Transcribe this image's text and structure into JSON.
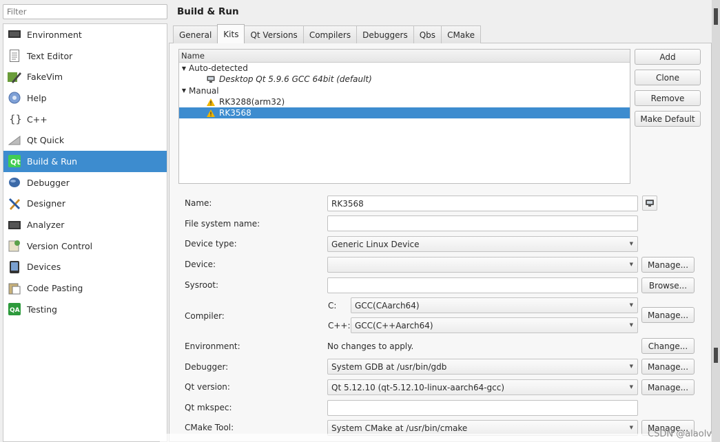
{
  "filter": {
    "placeholder": "Filter"
  },
  "sidebar": {
    "items": [
      {
        "label": "Environment",
        "icon": "monitor-icon"
      },
      {
        "label": "Text Editor",
        "icon": "text-document-icon"
      },
      {
        "label": "FakeVim",
        "icon": "fakevim-icon"
      },
      {
        "label": "Help",
        "icon": "help-globe-icon"
      },
      {
        "label": "C++",
        "icon": "braces-icon"
      },
      {
        "label": "Qt Quick",
        "icon": "qt-quick-icon"
      },
      {
        "label": "Build & Run",
        "icon": "build-run-icon",
        "selected": true
      },
      {
        "label": "Debugger",
        "icon": "debugger-bug-icon"
      },
      {
        "label": "Designer",
        "icon": "designer-brush-icon"
      },
      {
        "label": "Analyzer",
        "icon": "analyzer-icon"
      },
      {
        "label": "Version Control",
        "icon": "version-control-icon"
      },
      {
        "label": "Devices",
        "icon": "device-icon"
      },
      {
        "label": "Code Pasting",
        "icon": "clipboard-icon"
      },
      {
        "label": "Testing",
        "icon": "qa-testing-icon"
      }
    ]
  },
  "page_title": "Build & Run",
  "tabs": [
    "General",
    "Kits",
    "Qt Versions",
    "Compilers",
    "Debuggers",
    "Qbs",
    "CMake"
  ],
  "active_tab": "Kits",
  "kits_tree": {
    "header": "Name",
    "groups": [
      {
        "label": "Auto-detected",
        "items": [
          {
            "label": "Desktop Qt 5.9.6 GCC 64bit (default)",
            "icon": "desktop-icon",
            "italic": true
          }
        ]
      },
      {
        "label": "Manual",
        "items": [
          {
            "label": "RK3288(arm32)",
            "icon": "warning-icon"
          },
          {
            "label": "RK3568",
            "icon": "warning-icon",
            "selected": true
          }
        ]
      }
    ]
  },
  "kit_buttons": {
    "add": "Add",
    "clone": "Clone",
    "remove": "Remove",
    "make_default": "Make Default"
  },
  "form": {
    "name_label": "Name:",
    "name_value": "RK3568",
    "fs_name_label": "File system name:",
    "fs_name_value": "",
    "device_type_label": "Device type:",
    "device_type_value": "Generic Linux Device",
    "device_label": "Device:",
    "device_value": "",
    "sysroot_label": "Sysroot:",
    "sysroot_value": "",
    "compiler_label": "Compiler:",
    "compiler_c_label": "C:",
    "compiler_c_value": "GCC(CAarch64)",
    "compiler_cpp_label": "C++:",
    "compiler_cpp_value": "GCC(C++Aarch64)",
    "environment_label": "Environment:",
    "environment_value": "No changes to apply.",
    "debugger_label": "Debugger:",
    "debugger_value": "System GDB at /usr/bin/gdb",
    "qt_version_label": "Qt version:",
    "qt_version_value": "Qt 5.12.10 (qt-5.12.10-linux-aarch64-gcc)",
    "mkspec_label": "Qt mkspec:",
    "mkspec_value": "",
    "cmake_label": "CMake Tool:",
    "cmake_value": "System CMake at /usr/bin/cmake"
  },
  "side_buttons": {
    "manage": "Manage...",
    "browse": "Browse...",
    "change": "Change..."
  },
  "watermark": "CSDN @alaolv",
  "colors": {
    "selection": "#3d8ccf",
    "warning": "#f0b400"
  }
}
